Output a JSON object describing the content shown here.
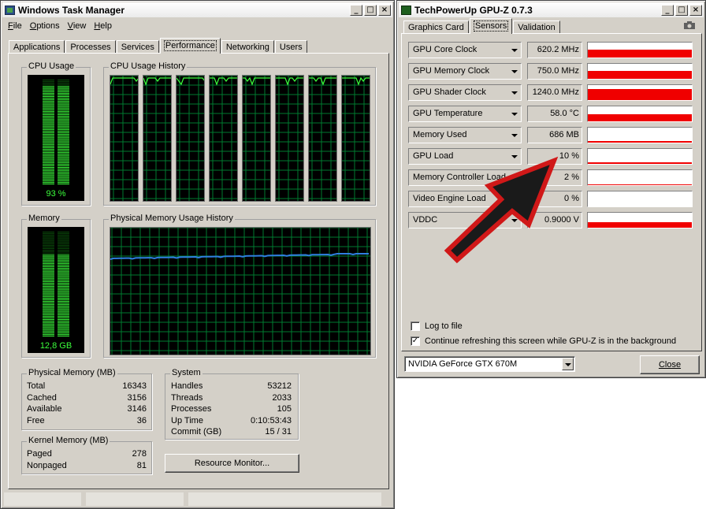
{
  "taskmanager": {
    "title": "Windows Task Manager",
    "menu": [
      "File",
      "Options",
      "View",
      "Help"
    ],
    "tabs": [
      "Applications",
      "Processes",
      "Services",
      "Performance",
      "Networking",
      "Users"
    ],
    "active_tab": "Performance",
    "cpu_usage": {
      "label": "CPU Usage",
      "value_text": "93 %",
      "level": 0.93
    },
    "cpu_history": {
      "label": "CPU Usage History",
      "cores": 8
    },
    "memory": {
      "label": "Memory",
      "value_text": "12,8 GB",
      "level": 0.78
    },
    "mem_history": {
      "label": "Physical Memory Usage History"
    },
    "physical_memory": {
      "label": "Physical Memory (MB)",
      "rows": [
        {
          "k": "Total",
          "v": "16343"
        },
        {
          "k": "Cached",
          "v": "3156"
        },
        {
          "k": "Available",
          "v": "3146"
        },
        {
          "k": "Free",
          "v": "36"
        }
      ]
    },
    "system": {
      "label": "System",
      "rows": [
        {
          "k": "Handles",
          "v": "53212"
        },
        {
          "k": "Threads",
          "v": "2033"
        },
        {
          "k": "Processes",
          "v": "105"
        },
        {
          "k": "Up Time",
          "v": "0:10:53:43"
        },
        {
          "k": "Commit (GB)",
          "v": "15 / 31"
        }
      ]
    },
    "kernel_memory": {
      "label": "Kernel Memory (MB)",
      "rows": [
        {
          "k": "Paged",
          "v": "278"
        },
        {
          "k": "Nonpaged",
          "v": "81"
        }
      ]
    },
    "resource_monitor_label": "Resource Monitor..."
  },
  "gpuz": {
    "title": "TechPowerUp GPU-Z 0.7.3",
    "tabs": [
      "Graphics Card",
      "Sensors",
      "Validation"
    ],
    "active_tab": "Sensors",
    "sensors": [
      {
        "name": "GPU Core Clock",
        "value": "620.2 MHz",
        "fill": 0.55
      },
      {
        "name": "GPU Memory Clock",
        "value": "750.0 MHz",
        "fill": 0.55
      },
      {
        "name": "GPU Shader Clock",
        "value": "1240.0 MHz",
        "fill": 0.75
      },
      {
        "name": "GPU Temperature",
        "value": "58.0 °C",
        "fill": 0.45
      },
      {
        "name": "Memory Used",
        "value": "686 MB",
        "fill": 0.12
      },
      {
        "name": "GPU Load",
        "value": "10 %",
        "fill": 0.1
      },
      {
        "name": "Memory Controller Load",
        "value": "2 %",
        "fill": 0.04
      },
      {
        "name": "Video Engine Load",
        "value": "0 %",
        "fill": 0.0
      },
      {
        "name": "VDDC",
        "value": "0.9000 V",
        "fill": 0.35
      }
    ],
    "log_to_file": {
      "label": "Log to file",
      "checked": false
    },
    "continue_refresh": {
      "label": "Continue refreshing this screen while GPU-Z is in the background",
      "checked": true
    },
    "gpu_select": "NVIDIA GeForce GTX 670M",
    "close_label": "Close"
  },
  "colors": {
    "fill_red": "#f00000",
    "meter_green": "#3cff3c",
    "graph_green": "#00c000",
    "mem_line": "#2f7fe0",
    "arrow_red": "#d01818"
  }
}
